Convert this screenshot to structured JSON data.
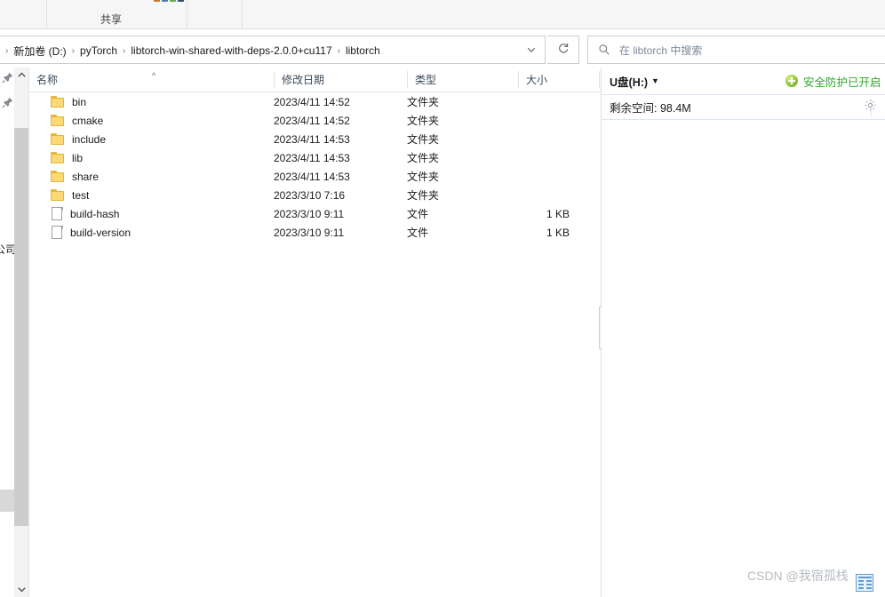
{
  "ribbon": {
    "share_tab_label": "共享",
    "mini_icon_colors": [
      "#c8772e",
      "#4a7ebb",
      "#6aa84f",
      "#2f4f73"
    ]
  },
  "address_bar": {
    "leading_separator": "›",
    "crumbs": [
      {
        "label": "新加卷 (D:)",
        "name": "crumb-new-volume-d"
      },
      {
        "label": "pyTorch",
        "name": "crumb-pytorch"
      },
      {
        "label": "libtorch-win-shared-with-deps-2.0.0+cu117",
        "name": "crumb-libtorch-win-shared"
      },
      {
        "label": "libtorch",
        "name": "crumb-libtorch"
      }
    ],
    "separator": "›",
    "dropdown_icon": "chevron-down-icon",
    "refresh_icon": "refresh-icon",
    "refresh_glyph": "↻"
  },
  "search": {
    "icon": "search-icon",
    "placeholder": "在 libtorch 中搜索"
  },
  "file_list": {
    "columns": [
      {
        "label": "名称",
        "name": "column-header-name",
        "sorted": true,
        "sort_indicator": "^"
      },
      {
        "label": "修改日期",
        "name": "column-header-date-modified"
      },
      {
        "label": "类型",
        "name": "column-header-type"
      },
      {
        "label": "大小",
        "name": "column-header-size"
      }
    ],
    "rows": [
      {
        "name": "bin",
        "date": "2023/4/11 14:52",
        "type": "文件夹",
        "size": "",
        "icon": "folder-icon"
      },
      {
        "name": "cmake",
        "date": "2023/4/11 14:52",
        "type": "文件夹",
        "size": "",
        "icon": "folder-icon"
      },
      {
        "name": "include",
        "date": "2023/4/11 14:53",
        "type": "文件夹",
        "size": "",
        "icon": "folder-icon"
      },
      {
        "name": "lib",
        "date": "2023/4/11 14:53",
        "type": "文件夹",
        "size": "",
        "icon": "folder-icon"
      },
      {
        "name": "share",
        "date": "2023/4/11 14:53",
        "type": "文件夹",
        "size": "",
        "icon": "folder-icon"
      },
      {
        "name": "test",
        "date": "2023/3/10 7:16",
        "type": "文件夹",
        "size": "",
        "icon": "folder-icon"
      },
      {
        "name": "build-hash",
        "date": "2023/3/10 9:11",
        "type": "文件",
        "size": "1 KB",
        "icon": "file-icon"
      },
      {
        "name": "build-version",
        "date": "2023/3/10 9:11",
        "type": "文件",
        "size": "1 KB",
        "icon": "file-icon"
      }
    ]
  },
  "navigation_gutter": {
    "pin_icon": "pin-icon",
    "clipped_label": "公司",
    "scroll_up_glyph": "︿",
    "scroll_down_glyph": "﹀"
  },
  "splitter": {
    "icon": "chevron-right-icon",
    "glyph": "❯"
  },
  "usb_panel": {
    "drive_label": "U盘(H:)",
    "drive_caret": "▼",
    "protection_icon": "green-plus-shield-icon",
    "protection_text": "安全防护已开启",
    "free_space_label": "剩余空间: 98.4M",
    "settings_icon": "gear-icon",
    "protection_color": "#2fa82f"
  },
  "watermark": {
    "text": "CSDN @我宿孤栈",
    "badge_icon": "blue-window-icon"
  }
}
